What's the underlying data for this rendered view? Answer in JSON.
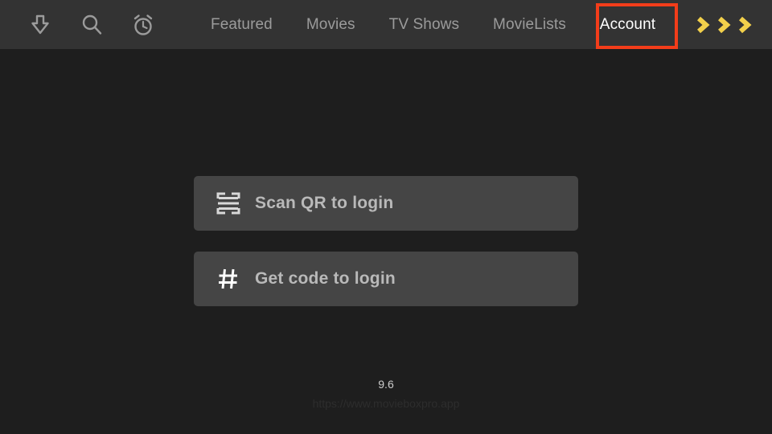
{
  "app": {
    "version": "9.6",
    "site_url": "https://www.movieboxpro.app",
    "colors": {
      "header_bg": "#333333",
      "page_bg": "#1e1e1e",
      "button_bg": "#454545",
      "accent_yellow": "#f2d04b",
      "focus_red": "#f33d1a",
      "nav_inactive": "#9b9b9b",
      "nav_active": "#ffffff"
    }
  },
  "header": {
    "icons": [
      {
        "name": "download-icon",
        "glyph": "download"
      },
      {
        "name": "search-icon",
        "glyph": "magnifier"
      },
      {
        "name": "alarm-clock-icon",
        "glyph": "alarm-clock"
      }
    ],
    "tabs": [
      {
        "label": "Featured",
        "selected": false
      },
      {
        "label": "Movies",
        "selected": false
      },
      {
        "label": "TV Shows",
        "selected": false
      },
      {
        "label": "MovieLists",
        "selected": false
      },
      {
        "label": "Account",
        "selected": true
      }
    ],
    "chevrons": {
      "count": 3,
      "icon": "double-chevron-right-icon"
    }
  },
  "main": {
    "login_options": [
      {
        "icon": "qr-scan-icon",
        "label": "Scan QR to login"
      },
      {
        "icon": "hash-icon",
        "label": "Get code to login"
      }
    ]
  }
}
